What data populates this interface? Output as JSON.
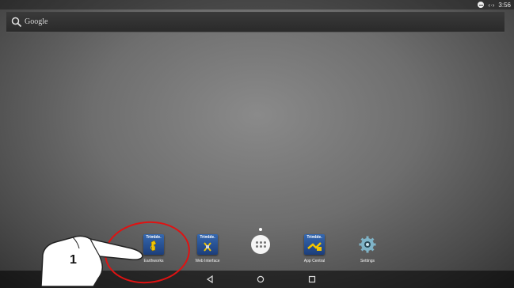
{
  "status_bar": {
    "time": "3:56"
  },
  "search": {
    "label": "Google"
  },
  "dock": {
    "apps": [
      {
        "label": "Earthworks",
        "brand": "Trimble."
      },
      {
        "label": "Web Interface",
        "brand": "Trimble."
      },
      {
        "label": "App Central",
        "brand": "Trimble."
      },
      {
        "label": "Settings"
      }
    ]
  },
  "annotation": {
    "step": "1"
  },
  "colors": {
    "annotation_ring": "#e01212",
    "trimble_blue": "#2a55a0"
  }
}
